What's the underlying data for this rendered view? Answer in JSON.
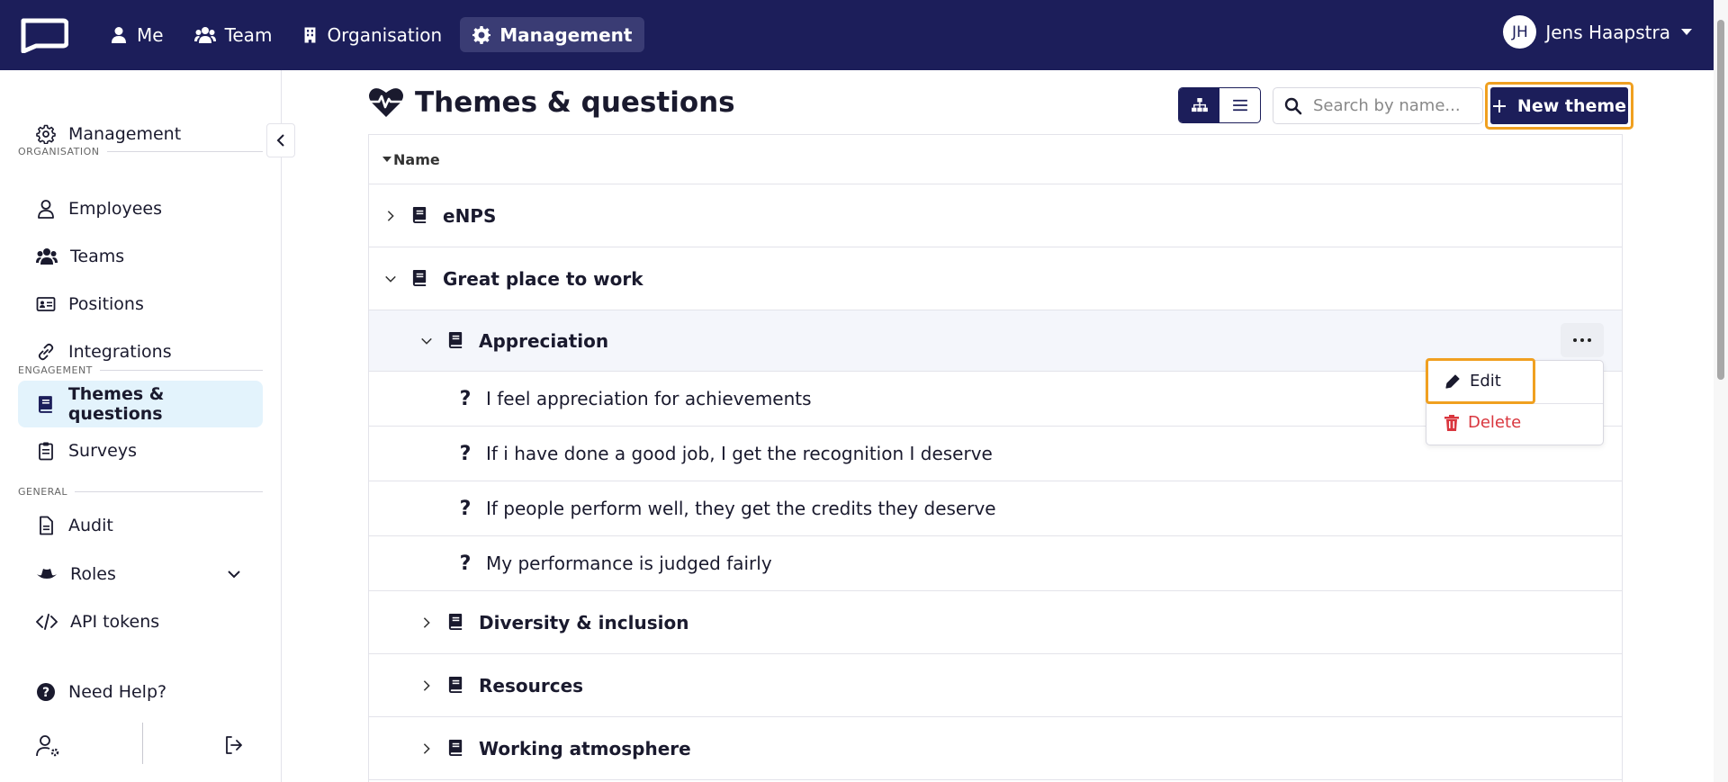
{
  "topnav": {
    "items": [
      {
        "label": "Me"
      },
      {
        "label": "Team"
      },
      {
        "label": "Organisation"
      },
      {
        "label": "Management"
      }
    ],
    "user": {
      "initials": "JH",
      "name": "Jens Haapstra"
    }
  },
  "sidebar": {
    "top_item": "Management",
    "sections": {
      "organisation": "ORGANISATION",
      "engagement": "ENGAGEMENT",
      "general": "GENERAL"
    },
    "items": {
      "employees": "Employees",
      "teams": "Teams",
      "positions": "Positions",
      "integrations": "Integrations",
      "themes": "Themes & questions",
      "surveys": "Surveys",
      "audit": "Audit",
      "roles": "Roles",
      "api_tokens": "API tokens",
      "help": "Need Help?"
    }
  },
  "main": {
    "title": "Themes & questions",
    "search_placeholder": "Search by name...",
    "new_theme_label": "New theme",
    "column_name": "Name",
    "rows": [
      {
        "label": "eNPS"
      },
      {
        "label": "Great place to work"
      },
      {
        "label": "Appreciation"
      },
      {
        "label": "I feel appreciation for achievements"
      },
      {
        "label": "If i have done a good job, I get the recognition I deserve"
      },
      {
        "label": "If people perform well, they get the credits they deserve"
      },
      {
        "label": "My performance is judged fairly"
      },
      {
        "label": "Diversity & inclusion"
      },
      {
        "label": "Resources"
      },
      {
        "label": "Working atmosphere"
      }
    ],
    "question_mark": "?",
    "menu": {
      "edit": "Edit",
      "delete": "Delete"
    }
  },
  "colors": {
    "nav_bg": "#1c1e5a",
    "accent_outline": "#f0a020",
    "delete_red": "#d9363e",
    "active_bg": "#e3f3fc"
  }
}
